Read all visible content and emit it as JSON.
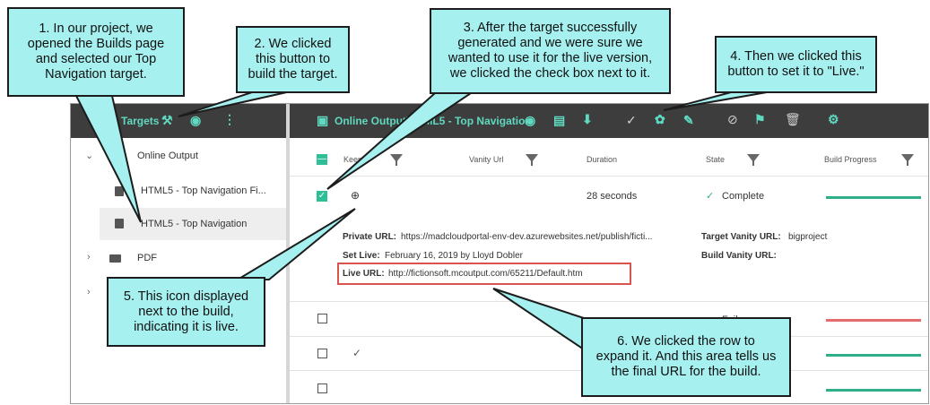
{
  "toolbar": {
    "left_label": "Targets",
    "path_label": "Online Output\\HTML5 - Top Navigation"
  },
  "tree": {
    "online_output": "Online Output",
    "fixed_target": "HTML5 - Top Navigation Fi...",
    "top_nav_target": "HTML5 - Top Navigation",
    "pdf": "PDF"
  },
  "table": {
    "headers": {
      "keep": "Keep",
      "vanity_url": "Vanity Url",
      "duration": "Duration",
      "state": "State",
      "build_progress": "Build Progress"
    },
    "expanded_row": {
      "duration": "28 seconds",
      "state": "Complete"
    },
    "details": {
      "private_url_label": "Private URL:",
      "private_url_value": "https://madcloudportal-env-dev.azurewebsites.net/publish/ficti...",
      "target_vanity_label": "Target Vanity URL:",
      "target_vanity_value": "bigproject",
      "set_live_label": "Set Live:",
      "set_live_value": "February 16, 2019 by Lloyd Dobler",
      "build_vanity_label": "Build Vanity URL:",
      "live_url_label": "Live URL:",
      "live_url_value": "http://fictionsoft.mcoutput.com/65211/Default.htm"
    },
    "row3_state_partial": "Fail..."
  },
  "callouts": {
    "c1": [
      "1. In our project, we",
      "opened the Builds page",
      "and selected our Top",
      "Navigation target."
    ],
    "c2": [
      "2. We clicked",
      "this button to",
      "build the target."
    ],
    "c3": [
      "3. After the target successfully",
      "generated and we were sure we",
      "wanted to use it for the live version,",
      "we clicked the check box next to it."
    ],
    "c4": [
      "4. Then we clicked this",
      "button to set it to \"Live.\""
    ],
    "c5": [
      "5. This icon displayed",
      "next to the build,",
      "indicating it is live."
    ],
    "c6": [
      "6. We clicked the row to",
      "expand it. And this area tells us",
      "the final URL for the build."
    ]
  },
  "colors": {
    "toolbar_bg": "#3d3d3d",
    "accent_teal": "#5fd9bf",
    "callout_fill": "#a6f0f0",
    "progress_green": "#2fae8a",
    "progress_red": "#e66b6b",
    "highlight_box": "#d9534f"
  },
  "icons": [
    "hammer-icon",
    "eye-icon",
    "more-vertical-icon",
    "html5-icon",
    "folder-icon",
    "clipboard-icon",
    "download-icon",
    "check-icon",
    "palette-icon",
    "pen-icon",
    "ban-icon",
    "runner-icon",
    "trash-icon",
    "gear-icon",
    "filter-icon",
    "globe-icon"
  ]
}
